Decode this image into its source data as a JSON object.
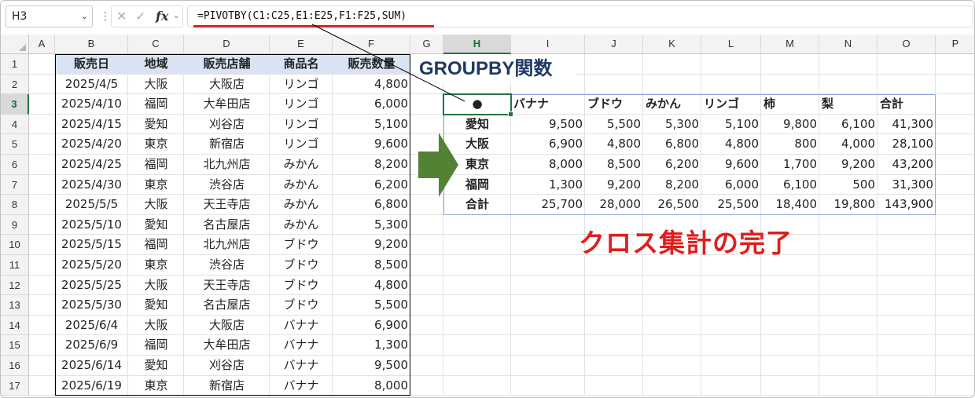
{
  "formula_bar": {
    "name_box": "H3",
    "fx_label": "fx",
    "formula": "=PIVOTBY(C1:C25,E1:E25,F1:F25,SUM)"
  },
  "columns": [
    "A",
    "B",
    "C",
    "D",
    "E",
    "F",
    "G",
    "H",
    "I",
    "J",
    "K",
    "L",
    "M",
    "N",
    "O",
    "P"
  ],
  "selected_column": "H",
  "rows": [
    "1",
    "2",
    "3",
    "4",
    "5",
    "6",
    "7",
    "8",
    "9",
    "10",
    "11",
    "12",
    "13",
    "14",
    "15",
    "16",
    "17"
  ],
  "selected_row": "3",
  "source_table": {
    "headers": [
      "販売日",
      "地域",
      "販売店舗",
      "商品名",
      "販売数量"
    ],
    "rows": [
      [
        "2025/4/5",
        "大阪",
        "大阪店",
        "リンゴ",
        "4,800"
      ],
      [
        "2025/4/10",
        "福岡",
        "大牟田店",
        "リンゴ",
        "6,000"
      ],
      [
        "2025/4/15",
        "愛知",
        "刈谷店",
        "リンゴ",
        "5,100"
      ],
      [
        "2025/4/20",
        "東京",
        "新宿店",
        "リンゴ",
        "9,600"
      ],
      [
        "2025/4/25",
        "福岡",
        "北九州店",
        "みかん",
        "8,200"
      ],
      [
        "2025/4/30",
        "東京",
        "渋谷店",
        "みかん",
        "6,200"
      ],
      [
        "2025/5/5",
        "大阪",
        "天王寺店",
        "みかん",
        "6,800"
      ],
      [
        "2025/5/10",
        "愛知",
        "名古屋店",
        "みかん",
        "5,300"
      ],
      [
        "2025/5/15",
        "福岡",
        "北九州店",
        "ブドウ",
        "9,200"
      ],
      [
        "2025/5/20",
        "東京",
        "渋谷店",
        "ブドウ",
        "8,500"
      ],
      [
        "2025/5/25",
        "大阪",
        "天王寺店",
        "ブドウ",
        "4,800"
      ],
      [
        "2025/5/30",
        "愛知",
        "名古屋店",
        "ブドウ",
        "5,500"
      ],
      [
        "2025/6/4",
        "大阪",
        "大阪店",
        "バナナ",
        "6,900"
      ],
      [
        "2025/6/9",
        "福岡",
        "大牟田店",
        "バナナ",
        "1,300"
      ],
      [
        "2025/6/14",
        "愛知",
        "刈谷店",
        "バナナ",
        "9,500"
      ],
      [
        "2025/6/19",
        "東京",
        "新宿店",
        "バナナ",
        "8,000"
      ]
    ]
  },
  "pivot": {
    "corner": "●",
    "headers": [
      "バナナ",
      "ブドウ",
      "みかん",
      "リンゴ",
      "柿",
      "梨",
      "合計"
    ],
    "rows": [
      {
        "label": "愛知",
        "values": [
          "9,500",
          "5,500",
          "5,300",
          "5,100",
          "9,800",
          "6,100",
          "41,300"
        ]
      },
      {
        "label": "大阪",
        "values": [
          "6,900",
          "4,800",
          "6,800",
          "4,800",
          "800",
          "4,000",
          "28,100"
        ]
      },
      {
        "label": "東京",
        "values": [
          "8,000",
          "8,500",
          "6,200",
          "9,600",
          "1,700",
          "9,200",
          "43,200"
        ]
      },
      {
        "label": "福岡",
        "values": [
          "1,300",
          "9,200",
          "8,200",
          "6,000",
          "6,100",
          "500",
          "31,300"
        ]
      },
      {
        "label": "合計",
        "values": [
          "25,700",
          "28,000",
          "26,500",
          "25,500",
          "18,400",
          "19,800",
          "143,900"
        ]
      }
    ]
  },
  "annotations": {
    "title": "GROUPBY関数",
    "done": "クロス集計の完了",
    "arrow_color": "#548235",
    "red_color": "#e01e1e"
  }
}
